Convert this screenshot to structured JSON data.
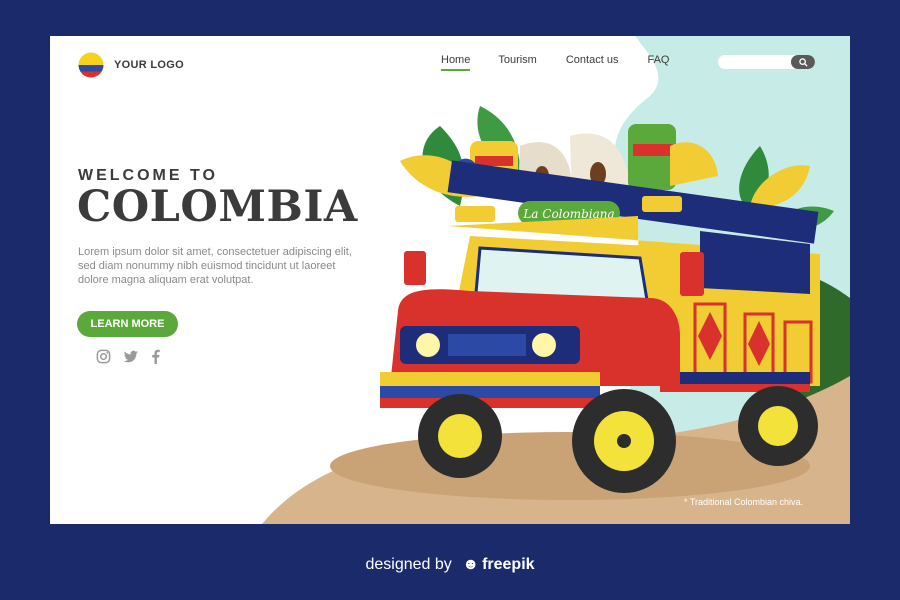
{
  "logo": {
    "text": "YOUR LOGO",
    "flag_colors": [
      "#f6d21c",
      "#2c4aa5",
      "#d9312b"
    ]
  },
  "nav": {
    "items": [
      {
        "label": "Home",
        "active": true
      },
      {
        "label": "Tourism",
        "active": false
      },
      {
        "label": "Contact us",
        "active": false
      },
      {
        "label": "FAQ",
        "active": false
      }
    ]
  },
  "search": {
    "placeholder": ""
  },
  "hero": {
    "kicker": "WELCOME TO",
    "title": "COLOMBIA",
    "body": "Lorem ipsum dolor sit amet, consectetuer adipiscing elit, sed diam nonummy nibh euismod tincidunt ut laoreet dolore magna aliquam erat volutpat.",
    "cta": "LEARN MORE"
  },
  "social": [
    "instagram-icon",
    "twitter-icon",
    "facebook-icon"
  ],
  "illustration": {
    "bus_sign": "La Colombiana",
    "caption": "* Traditional Colombian chiva."
  },
  "credit": {
    "prefix": "designed by",
    "brand": "freepik"
  },
  "colors": {
    "page_bg": "#1b2a6b",
    "accent": "#5ca93b",
    "sky": "#c7ece8",
    "ground": "#d8b48c",
    "hills": "#2f6a2b"
  }
}
